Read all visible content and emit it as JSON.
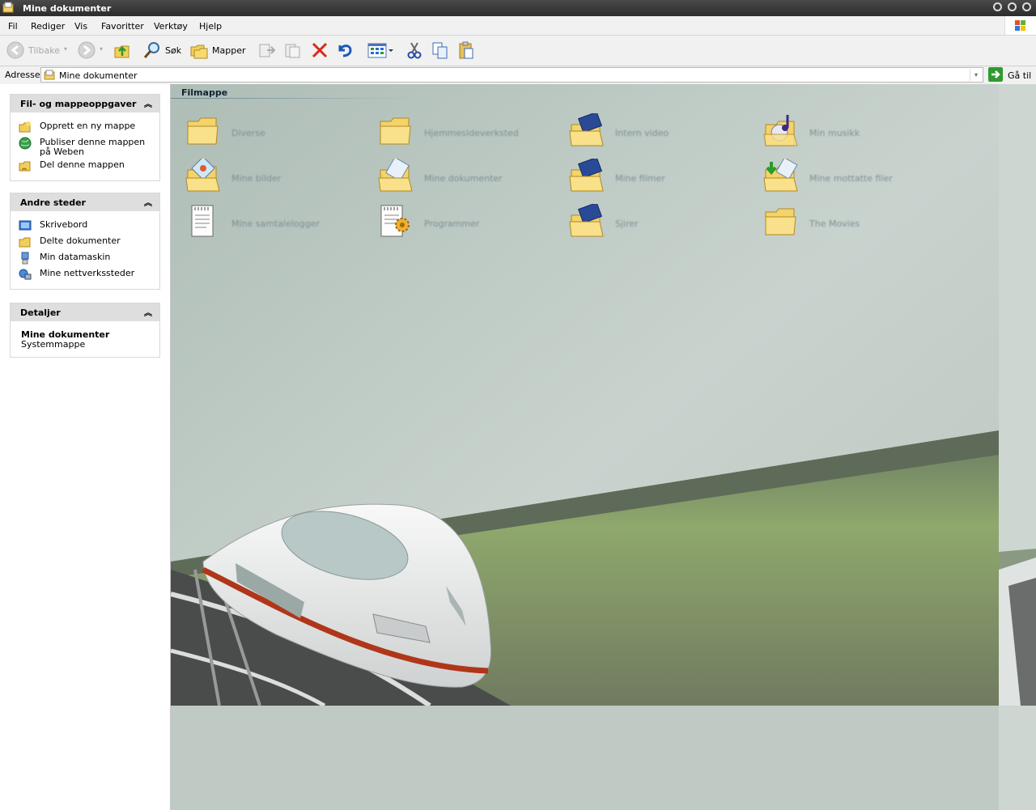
{
  "window": {
    "title": "Mine dokumenter"
  },
  "menu": [
    "Fil",
    "Rediger",
    "Vis",
    "Favoritter",
    "Verktøy",
    "Hjelp"
  ],
  "toolbar": {
    "back_label": "Tilbake",
    "search_label": "Søk",
    "folders_label": "Mapper"
  },
  "address": {
    "label": "Adresse",
    "value": "Mine dokumenter",
    "go_label": "Gå til"
  },
  "left_panel": {
    "file_tasks": {
      "title": "Fil- og mappeoppgaver",
      "items": [
        "Opprett en ny mappe",
        "Publiser denne mappen på Weben",
        "Del denne mappen"
      ]
    },
    "other_places": {
      "title": "Andre steder",
      "items": [
        "Skrivebord",
        "Delte dokumenter",
        "Min datamaskin",
        "Mine nettverkssteder"
      ]
    },
    "details": {
      "title": "Detaljer",
      "name": "Mine dokumenter",
      "type": "Systemmappe"
    }
  },
  "content": {
    "group_title": "Filmappe",
    "items": [
      {
        "name": "Diverse",
        "icon": "folder-icon"
      },
      {
        "name": "Hjemmesideverksted",
        "icon": "folder-icon"
      },
      {
        "name": "Intern video",
        "icon": "video-folder-icon"
      },
      {
        "name": "Min musikk",
        "icon": "music-folder-icon"
      },
      {
        "name": "Mine bilder",
        "icon": "pictures-folder-icon"
      },
      {
        "name": "Mine dokumenter",
        "icon": "documents-folder-icon"
      },
      {
        "name": "Mine filmer",
        "icon": "video-folder-icon"
      },
      {
        "name": "Mine mottatte filer",
        "icon": "received-files-folder-icon"
      },
      {
        "name": "Mine samtalelogger",
        "icon": "text-document-icon"
      },
      {
        "name": "Programmer",
        "icon": "programs-icon"
      },
      {
        "name": "Sjirer",
        "icon": "video-folder-icon"
      },
      {
        "name": "The Movies",
        "icon": "folder-icon"
      }
    ]
  }
}
